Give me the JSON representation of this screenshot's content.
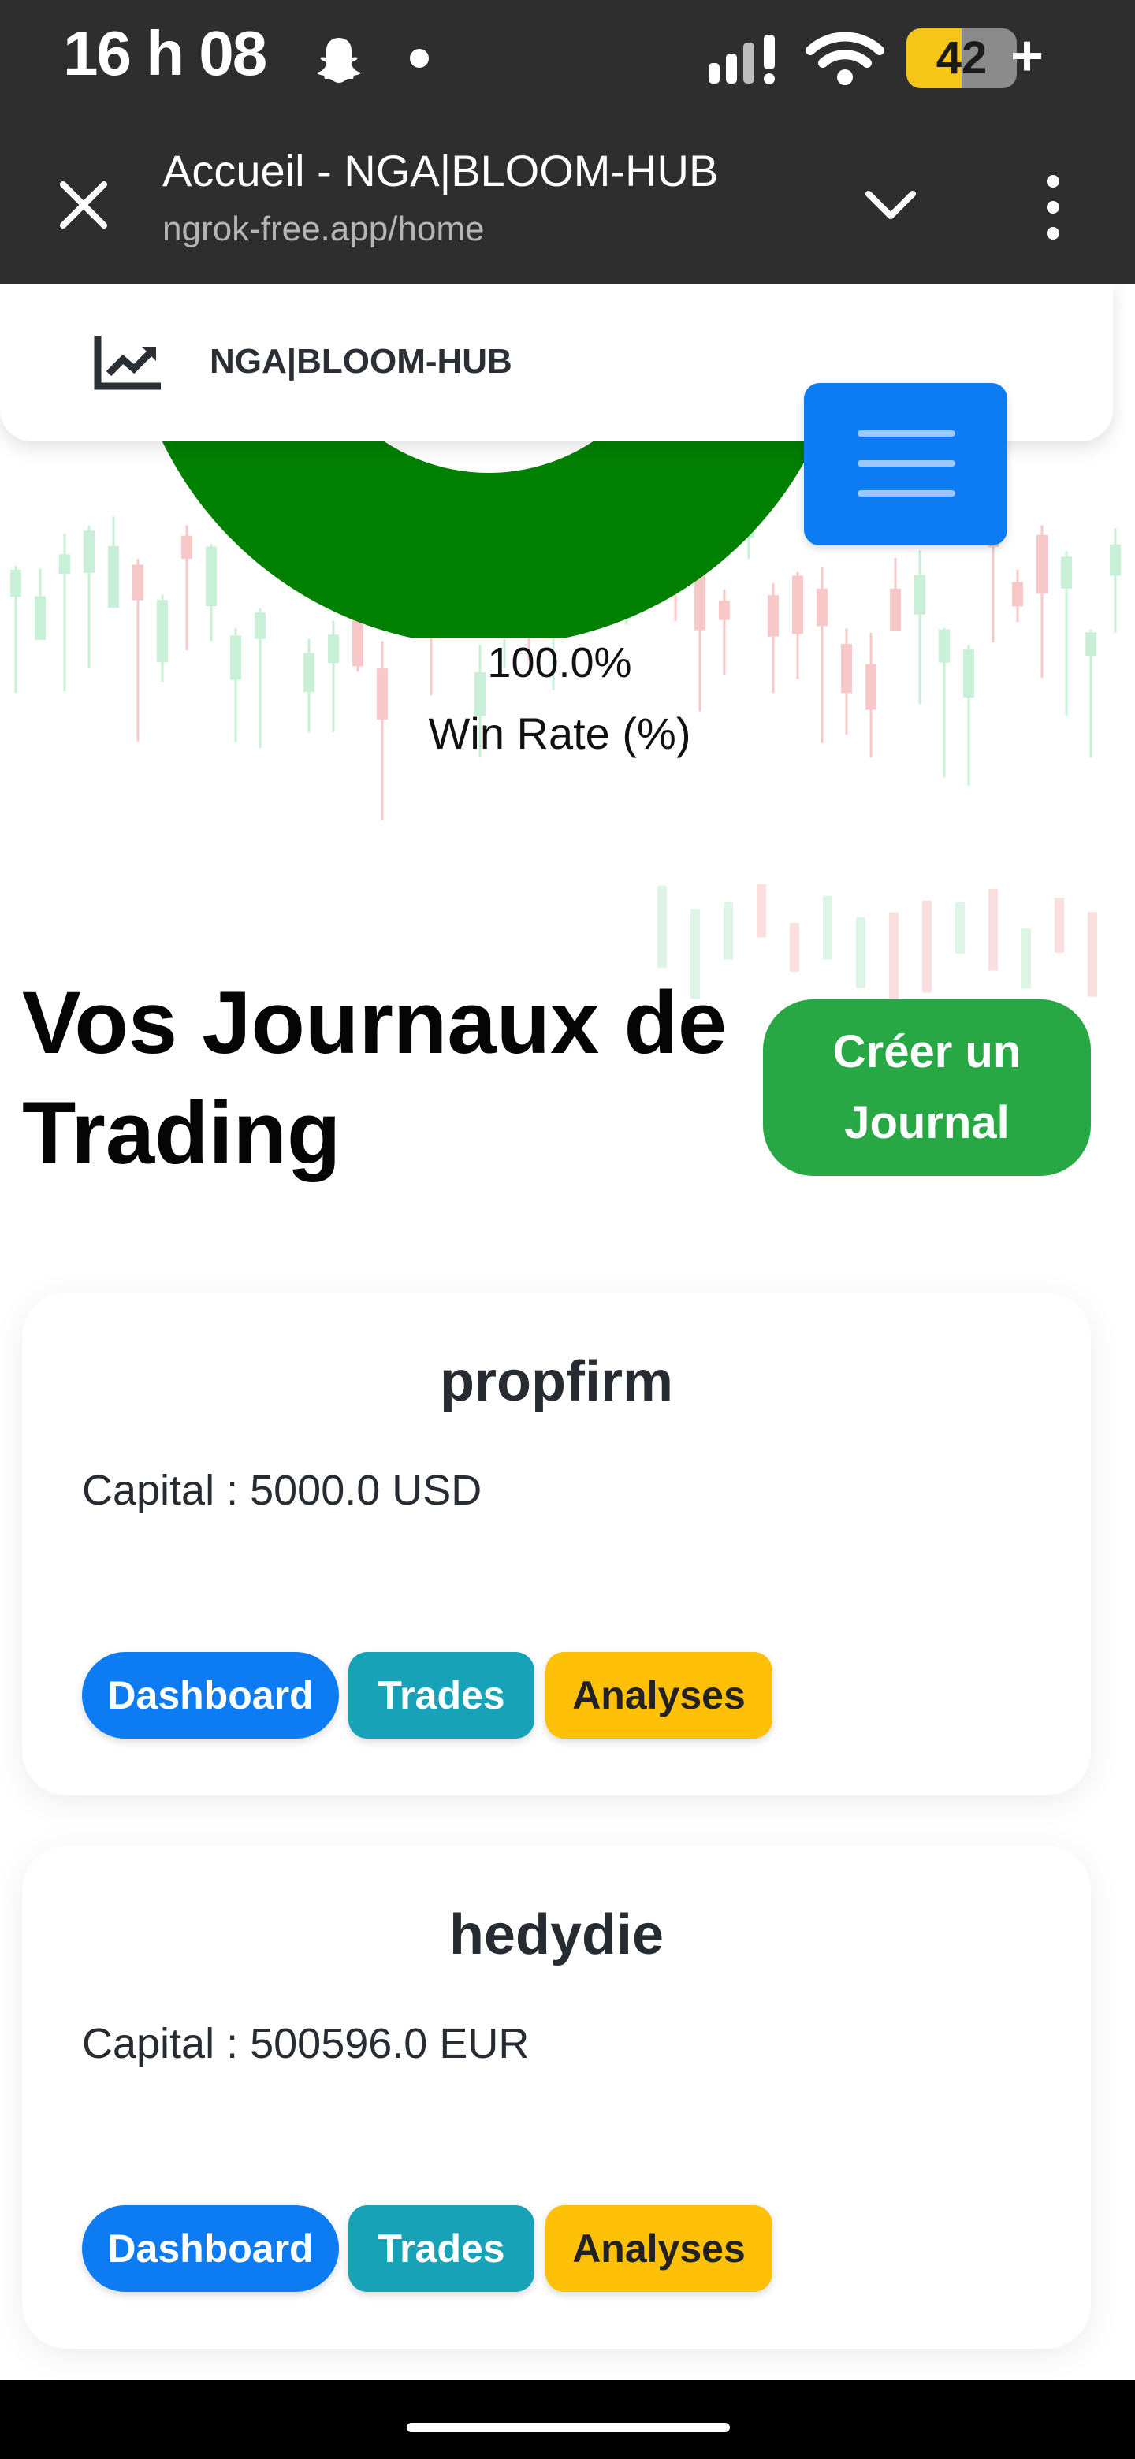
{
  "status_bar": {
    "time": "16 h 08",
    "battery": "42",
    "battery_plus": "+"
  },
  "browser": {
    "title": "Accueil - NGA|BLOOM-HUB",
    "url": "ngrok-free.app/home"
  },
  "navbar": {
    "brand": "NGA|BLOOM-HUB"
  },
  "stats": {
    "win_rate_value": "100.0%",
    "win_rate_label": "Win Rate (%)",
    "win_rate_fraction": 1.0,
    "win_color": "#008000"
  },
  "journals": {
    "heading": "Vos Journaux de Trading",
    "create_button": "Créer un Journal",
    "items": [
      {
        "name": "propfirm",
        "capital": "Capital : 5000.0 USD",
        "dashboard": "Dashboard",
        "trades": "Trades",
        "analyses": "Analyses"
      },
      {
        "name": "hedydie",
        "capital": "Capital : 500596.0 EUR",
        "dashboard": "Dashboard",
        "trades": "Trades",
        "analyses": "Analyses"
      }
    ]
  },
  "colors": {
    "primary": "#0d7cf2",
    "success": "#28a745",
    "info": "#18a2b8",
    "warning": "#ffc107"
  }
}
